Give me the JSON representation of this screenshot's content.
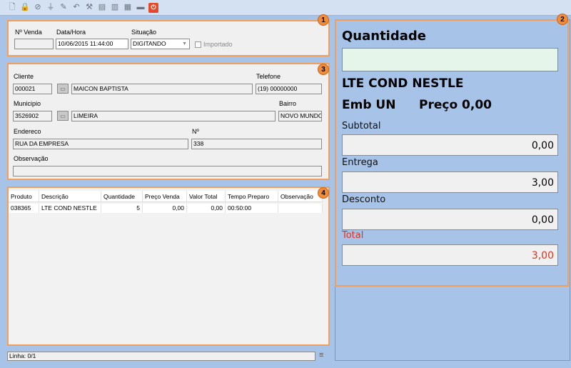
{
  "toolbar": {
    "buttons": [
      {
        "icon": "new-document-icon",
        "glyph": "🗋"
      },
      {
        "icon": "lock-icon",
        "glyph": "🔒"
      },
      {
        "icon": "cancel-icon",
        "glyph": "⊘"
      },
      {
        "icon": "filter-icon",
        "glyph": "⏚"
      },
      {
        "icon": "edit-icon",
        "glyph": "✎"
      },
      {
        "icon": "undo-icon",
        "glyph": "↶"
      },
      {
        "icon": "wand-icon",
        "glyph": "⚒"
      },
      {
        "icon": "print-icon",
        "glyph": "▤"
      },
      {
        "icon": "report-icon",
        "glyph": "▥"
      },
      {
        "icon": "document-icon",
        "glyph": "▦"
      },
      {
        "icon": "card-icon",
        "glyph": "▬"
      },
      {
        "icon": "power-icon",
        "glyph": "⏻"
      }
    ]
  },
  "badges": {
    "b1": "1",
    "b2": "2",
    "b3": "3",
    "b4": "4"
  },
  "header": {
    "nvenda_label": "Nº Venda",
    "nvenda_value": "",
    "datahora_label": "Data/Hora",
    "datahora_value": "10/06/2015 11:44:00",
    "situacao_label": "Situação",
    "situacao_value": "DIGITANDO",
    "importado_label": "Importado"
  },
  "cliente": {
    "cliente_label": "Cliente",
    "cliente_code": "000021",
    "cliente_name": "MAICON BAPTISTA",
    "telefone_label": "Telefone",
    "telefone_value": "(19) 00000000",
    "municipio_label": "Municipio",
    "municipio_code": "3526902",
    "municipio_name": "LIMEIRA",
    "bairro_label": "Bairro",
    "bairro_value": "NOVO MUNDO",
    "endereco_label": "Endereco",
    "endereco_value": "RUA DA EMPRESA",
    "numero_label": "Nº",
    "numero_value": "338",
    "observacao_label": "Observação",
    "observacao_value": ""
  },
  "grid": {
    "columns": [
      "Produto",
      "Descrição",
      "Quantidade",
      "Preço Venda",
      "Valor Total",
      "Tempo Preparo",
      "Observação"
    ],
    "rows": [
      [
        "038365",
        "LTE COND NESTLE",
        "5",
        "0,00",
        "0,00",
        "00:50:00",
        ""
      ]
    ]
  },
  "status": {
    "linha": "Linha: 0/1"
  },
  "summary": {
    "quantidade_label": "Quantidade",
    "quantidade_value": "",
    "product_name": "LTE COND NESTLE",
    "emb": "Emb UN",
    "preco": "Preço 0,00",
    "subtotal_label": "Subtotal",
    "subtotal_value": "0,00",
    "entrega_label": "Entrega",
    "entrega_value": "3,00",
    "desconto_label": "Desconto",
    "desconto_value": "0,00",
    "total_label": "Total",
    "total_value": "3,00"
  },
  "colors": {
    "accent_orange": "#f0a05c",
    "total_red": "#e2321c",
    "background_blue": "#a7c3e8",
    "quantity_green": "#e6f5ea"
  }
}
